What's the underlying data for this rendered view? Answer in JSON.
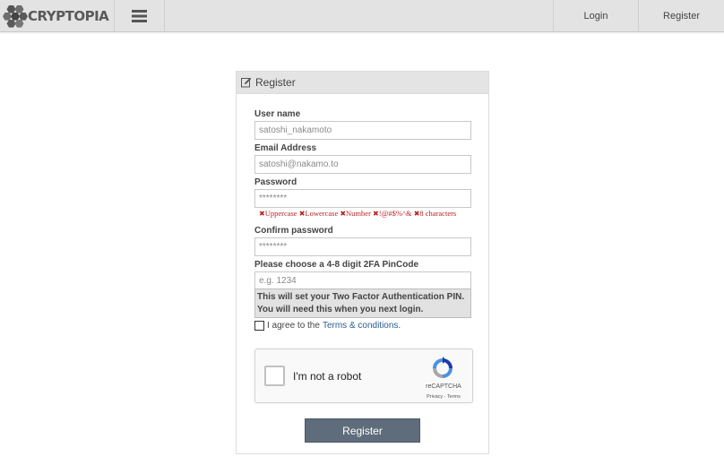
{
  "brand": {
    "logo_text": "CRYPTOPIA"
  },
  "nav": {
    "login": "Login",
    "register": "Register"
  },
  "panel": {
    "title": "Register"
  },
  "form": {
    "username_label": "User name",
    "username_value": "satoshi_nakamoto",
    "email_label": "Email Address",
    "email_value": "satoshi@nakamo.to",
    "password_label": "Password",
    "password_value": "********",
    "password_rules": [
      {
        "label": "Uppercase",
        "met": false
      },
      {
        "label": "Lowercase",
        "met": false
      },
      {
        "label": "Number",
        "met": false
      },
      {
        "label": "!@#$%^&",
        "met": false
      },
      {
        "label": "8 characters",
        "met": false
      }
    ],
    "confirm_label": "Confirm password",
    "confirm_value": "********",
    "pin_label": "Please choose a 4-8 digit 2FA PinCode",
    "pin_placeholder": "e.g. 1234",
    "pin_note_line1": "This will set your Two Factor Authentication PIN.",
    "pin_note_line2": "You will need this when you next login.",
    "agree_text": "I agree to the",
    "terms_link": "Terms & conditions",
    "terms_suffix": ".",
    "submit_label": "Register"
  },
  "captcha": {
    "label": "I'm not a robot",
    "brand": "reCAPTCHA",
    "privacy": "Privacy",
    "separator": " - ",
    "terms": "Terms"
  },
  "colors": {
    "accent_link": "#2a5d8f",
    "error_red": "#bb2222",
    "button_bg": "#5f6c7b",
    "navbar_bg": "#e3e3e3"
  }
}
